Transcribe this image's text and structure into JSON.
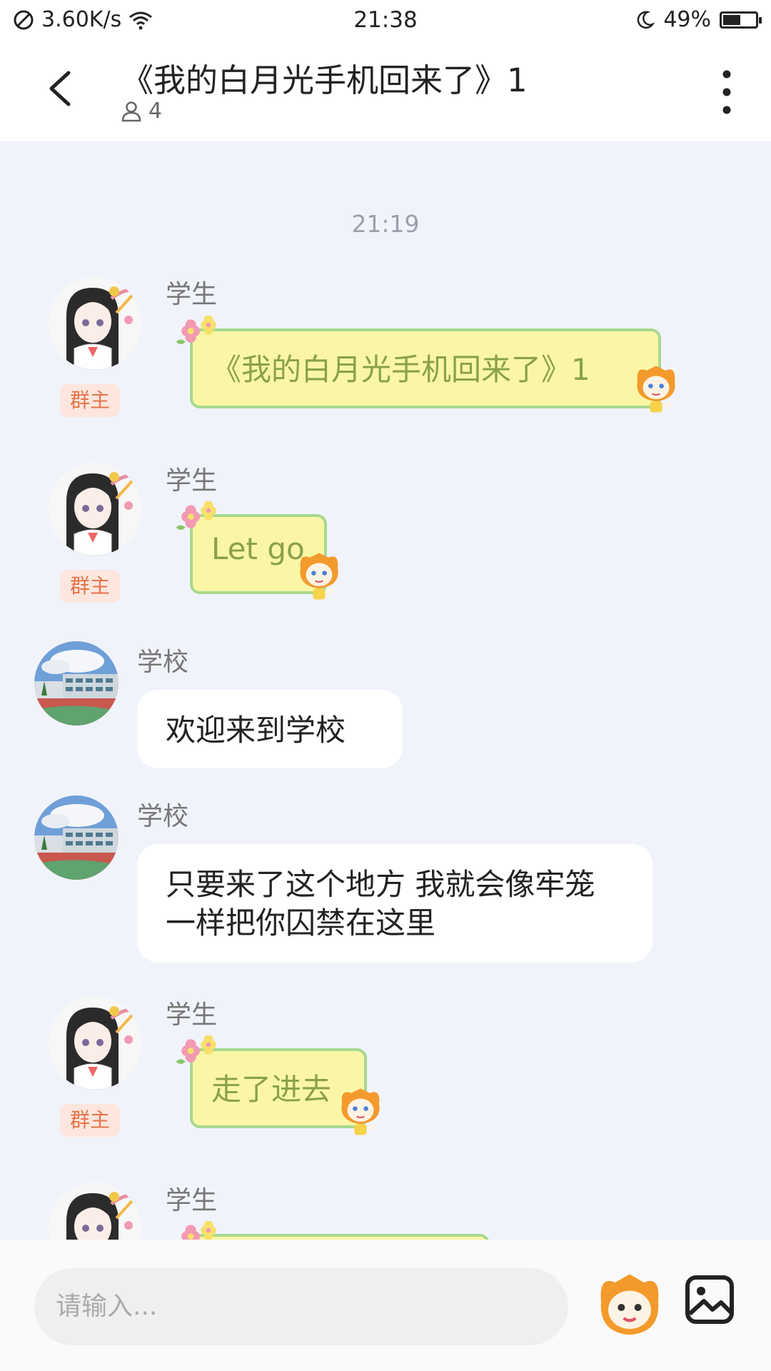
{
  "status_bar": {
    "network_speed": "3.60K/s",
    "time": "21:38",
    "battery": "49%",
    "battery_level": 0.49
  },
  "header": {
    "title": "《我的白月光手机回来了》1",
    "member_count": "4"
  },
  "chat": {
    "timestamp": "21:19",
    "messages": [
      {
        "sender": "学生",
        "badge": "群主",
        "text": "《我的白月光手机回来了》1",
        "style": "green"
      },
      {
        "sender": "学生",
        "badge": "群主",
        "text": "Let go",
        "style": "green"
      },
      {
        "sender": "学校",
        "text": "欢迎来到学校",
        "style": "white"
      },
      {
        "sender": "学校",
        "text": "只要来了这个地方 我就会像牢笼一样把你囚禁在这里",
        "style": "white"
      },
      {
        "sender": "学生",
        "badge": "群主",
        "text": "走了进去",
        "style": "green"
      },
      {
        "sender": "学生",
        "style": "green"
      }
    ]
  },
  "input": {
    "placeholder": "请输入..."
  },
  "icons": {
    "signal": "no-sim-icon",
    "wifi": "wifi-icon",
    "moon": "moon-icon",
    "battery": "battery-icon",
    "back": "back-arrow-icon",
    "member": "person-icon",
    "more": "more-vertical-icon",
    "emoji": "emoji-mascot-icon",
    "image": "image-icon"
  },
  "colors": {
    "bubble_green_fill": "#fbf6a6",
    "bubble_green_border": "#a8d88e",
    "badge_text": "#e5744a",
    "background": "#f1f3fb"
  }
}
